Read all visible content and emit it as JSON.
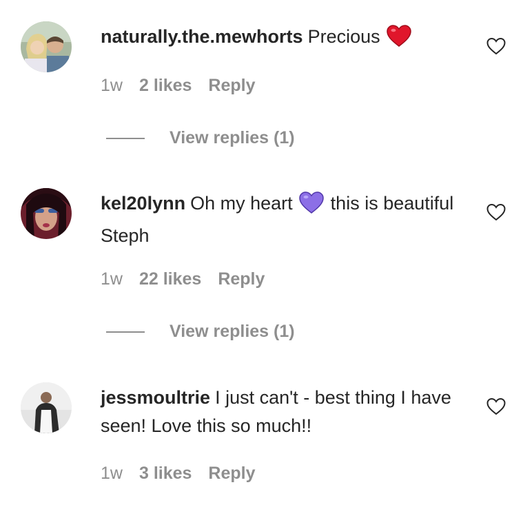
{
  "comments": [
    {
      "username": "naturally.the.mewhorts",
      "text_before": "Precious",
      "emoji": "red-heart",
      "text_after": "",
      "time": "1w",
      "likes": "2 likes",
      "reply": "Reply",
      "view_replies": "View replies (1)"
    },
    {
      "username": "kel20lynn",
      "text_before": "Oh my heart",
      "emoji": "purple-heart",
      "text_after": "this is beautiful Steph",
      "time": "1w",
      "likes": "22 likes",
      "reply": "Reply",
      "view_replies": "View replies (1)"
    },
    {
      "username": "jessmoultrie",
      "text_before": "I just can't - best thing I have seen! Love this so much!!",
      "time": "1w",
      "likes": "3 likes",
      "reply": "Reply"
    }
  ],
  "colors": {
    "primary_text": "#262626",
    "secondary_text": "#8e8e8e",
    "heart_red": "#e0162b",
    "heart_purple": "#8c6fe6"
  }
}
